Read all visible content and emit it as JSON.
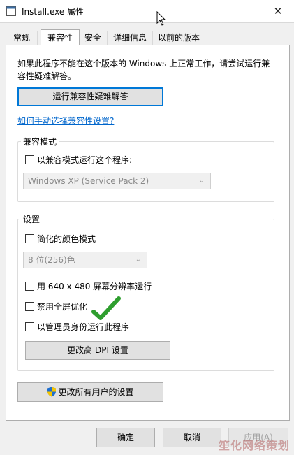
{
  "window": {
    "title": "Install.exe 属性",
    "close_glyph": "✕"
  },
  "tabs": [
    {
      "label": "常规"
    },
    {
      "label": "兼容性"
    },
    {
      "label": "安全"
    },
    {
      "label": "详细信息"
    },
    {
      "label": "以前的版本"
    }
  ],
  "compat": {
    "intro_line1": "如果此程序不能在这个版本的 Windows 上正常工作，请尝试运行兼",
    "intro_line2": "容性疑难解答。",
    "troubleshoot_button": "运行兼容性疑难解答",
    "manual_link": "如何手动选择兼容性设置?",
    "mode_group_label": "兼容模式",
    "mode_checkbox_label": "以兼容模式运行这个程序:",
    "mode_select_value": "Windows XP (Service Pack 2)",
    "settings_group_label": "设置",
    "reduced_color_label": "简化的颜色模式",
    "color_select_value": "8 位(256)色",
    "res_640_label": "用 640 x 480 屏幕分辨率运行",
    "disable_fullscreen_label": "禁用全屏优化",
    "run_as_admin_label": "以管理员身份运行此程序",
    "dpi_button": "更改高 DPI 设置",
    "all_users_button": "更改所有用户的设置"
  },
  "footer": {
    "ok_button": "确定",
    "cancel_button": "取消",
    "apply_button": "应用(A)"
  },
  "overlay": {
    "watermark_text": "笙化网络策划"
  },
  "colors": {
    "accent": "#0078d7",
    "link": "#0066cc",
    "checkmark": "#2e9e2e"
  }
}
